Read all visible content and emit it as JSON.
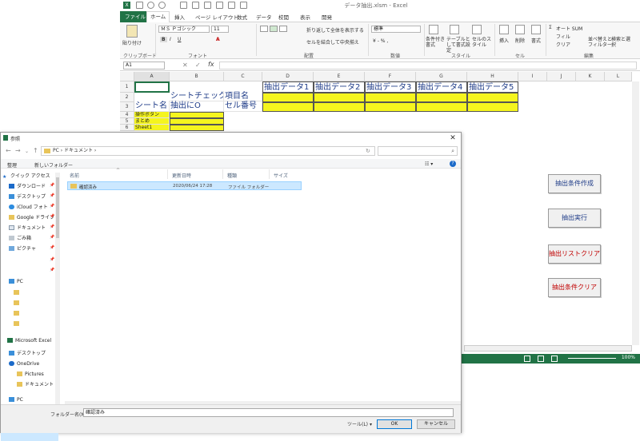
{
  "excel": {
    "title": "データ抽出.xlsm - Excel",
    "tabs": [
      "ファイル",
      "ホーム",
      "挿入",
      "ページ レイアウト",
      "数式",
      "データ",
      "校閲",
      "表示",
      "開発"
    ],
    "ribbon": {
      "paste": "貼り付け",
      "clipboard_group": "クリップボード",
      "font_name": "ＭＳ Ｐゴシック",
      "font_size": "11",
      "font_group": "フォント",
      "wrap_text": "折り返して全体を表示する",
      "merge_center": "セルを結合して中央揃え",
      "align_group": "配置",
      "number_format": "標準",
      "number_group": "数値",
      "cond_format": "条件付き書式",
      "table_format": "テーブルとして書式設定",
      "cell_style": "セルのスタイル",
      "style_group": "スタイル",
      "insert": "挿入",
      "delete": "削除",
      "format": "書式",
      "cells_group": "セル",
      "autosum": "オート SUM",
      "fill": "フィル",
      "clear": "クリア",
      "sort_filter": "並べ替えとフィルター",
      "find_select": "検索と選択",
      "edit_group": "編集"
    },
    "name_box": "A1",
    "fx": "fx",
    "columns": [
      "A",
      "B",
      "C",
      "D",
      "E",
      "F",
      "G",
      "H",
      "I",
      "J",
      "K",
      "L"
    ],
    "rows": [
      "1",
      "2",
      "3",
      "4",
      "5",
      "6"
    ],
    "cells": {
      "d1": "抽出データ1",
      "e1": "抽出データ2",
      "f1": "抽出データ3",
      "g1": "抽出データ4",
      "h1": "抽出データ5",
      "b2": "シートチェック",
      "c2": "項目名",
      "a3": "シート名",
      "b3": "抽出にO",
      "c3": "セル番号",
      "a4": "操作ボタン",
      "a5": "まとめ",
      "a6": "Sheet1"
    },
    "buttons": {
      "create_condition": "抽出条件作成",
      "run": "抽出実行",
      "clear_list": "抽出リストクリア",
      "clear_condition": "抽出条件クリア"
    },
    "zoom": "100%"
  },
  "dialog": {
    "title": "参照",
    "address": "PC › ドキュメント ›",
    "toolbar": {
      "organize": "整理",
      "new_folder": "新しいフォルダー"
    },
    "nav": [
      "クイック アクセス",
      "ダウンロード",
      "デスクトップ",
      "iCloud フォト",
      "Google ドライブ",
      "ドキュメント",
      "ごみ箱",
      "ピクチャ",
      "PC",
      "Microsoft Excel",
      "デスクトップ",
      "OneDrive",
      "Pictures",
      "ドキュメント",
      "PC"
    ],
    "columns": {
      "name": "名前",
      "date": "更新日時",
      "type": "種類",
      "size": "サイズ"
    },
    "files": [
      {
        "name": "確認済み",
        "date": "2020/06/24 17:28",
        "type": "ファイル フォルダー",
        "size": ""
      }
    ],
    "folder_label": "フォルダー名(N):",
    "folder_value": "確認済み",
    "tools": "ツール(L)",
    "ok": "OK",
    "cancel": "キャンセル"
  },
  "colors": {
    "excel_green": "#217346",
    "highlight_yellow": "#f5f51e",
    "red_text": "#c00000",
    "blue_text": "#1f3c88",
    "selection": "#cce8ff"
  }
}
